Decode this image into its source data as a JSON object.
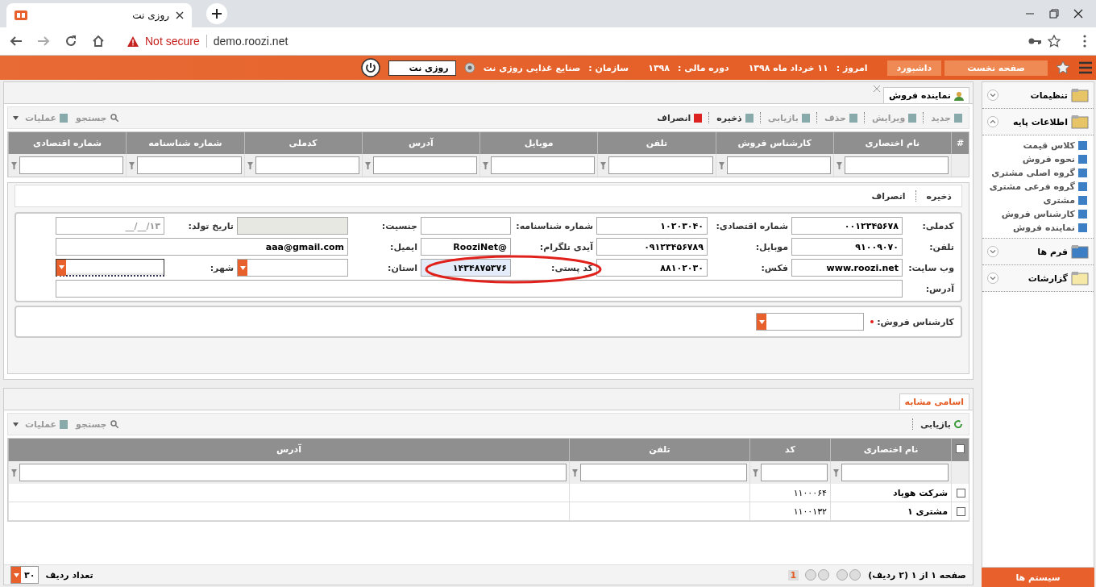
{
  "browser": {
    "tab_title": "روزی نت",
    "security": "Not secure",
    "url": "demo.roozi.net"
  },
  "header": {
    "buttons": [
      {
        "label": "صفحه نخست"
      },
      {
        "label": "داشبورد"
      }
    ],
    "info": [
      {
        "label": "امروز :",
        "value": "۱۱ خرداد ماه ۱۳۹۸"
      },
      {
        "label": "دوره مالی :",
        "value": "۱۳۹۸"
      },
      {
        "label": "سازمان :",
        "value": "صنایع غذایی روزی نت"
      }
    ],
    "company": "روزی نت"
  },
  "page_tab": {
    "label": "نماینده فروش"
  },
  "toolbar": {
    "actions": [
      {
        "label": "جدید",
        "disabled": true
      },
      {
        "label": "ویرایش",
        "disabled": true
      },
      {
        "label": "حذف",
        "disabled": true
      },
      {
        "label": "بازیابی",
        "disabled": true
      },
      {
        "label": "ذخیره",
        "disabled": false
      },
      {
        "label": "انصراف",
        "disabled": false
      }
    ],
    "search": "جستجو",
    "operations": "عملیات"
  },
  "grid": {
    "index_header": "#",
    "columns": [
      "نام اختصاری",
      "کارشناس فروش",
      "تلفن",
      "موبایل",
      "آدرس",
      "کدملی",
      "شماره شناسنامه",
      "شماره اقتصادی"
    ]
  },
  "form_toolbar": [
    "ذخیره",
    "انصراف"
  ],
  "form": {
    "rows": [
      [
        {
          "label": "کدملی:",
          "value": "۰۰۱۲۳۴۵۶۷۸",
          "kind": "text"
        },
        {
          "label": "شماره اقتصادی:",
          "value": "۱۰۲۰۳۰۴۰",
          "kind": "text"
        },
        {
          "label": "شماره شناسنامه:",
          "kind": "text"
        },
        {
          "label": "جنسیت:",
          "kind": "disabled"
        },
        {
          "label": "تاریخ تولد:",
          "placeholder": "__/__/۱۳",
          "kind": "date"
        }
      ],
      [
        {
          "label": "تلفن:",
          "value": "۹۱۰۰۹۰۷۰",
          "kind": "text"
        },
        {
          "label": "موبایل:",
          "value": "۰۹۱۲۳۴۵۶۷۸۹",
          "kind": "text"
        },
        {
          "label": "آیدی تلگرام:",
          "value": "RooziNet@",
          "kind": "text"
        },
        {
          "label": "ایمیل:",
          "value": "aaa@gmail.com",
          "kind": "text"
        }
      ],
      [
        {
          "label": "وب سایت:",
          "value": "www.roozi.net",
          "kind": "text"
        },
        {
          "label": "فکس:",
          "value": "۸۸۱۰۲۰۳۰",
          "kind": "text"
        },
        {
          "label": "کد پستی:",
          "value": "۱۴۳۴۸۷۵۳۷۶",
          "kind": "text",
          "highlighted": true
        },
        {
          "label": "استان:",
          "kind": "select"
        },
        {
          "label": "شهر:",
          "kind": "select",
          "focused": true
        }
      ],
      [
        {
          "label": "آدرس:",
          "kind": "text"
        }
      ]
    ],
    "sales_expert": {
      "label": "کارشناس فروش:",
      "required": true
    }
  },
  "similar": {
    "tab": {
      "label": "اسامی مشابه",
      "selected": true
    },
    "refresh": "بازیابی",
    "search": "جستجو",
    "operations": "عملیات",
    "columns": [
      "نام اختصاری",
      "کد",
      "تلفن",
      "آدرس"
    ],
    "all_checked": false,
    "rows": [
      {
        "checked": false,
        "cells": [
          "شرکت هویاد",
          "۱۱۰۰۰۶۴"
        ]
      },
      {
        "checked": false,
        "cells": [
          "مشتری ۱",
          "۱۱۰۰۱۳۲"
        ]
      }
    ]
  },
  "pager": {
    "summary": "صفحه ۱ از ۱ (۲ ردیف)",
    "page": "1",
    "size_label": "تعداد ردیف",
    "size": "۳۰"
  },
  "sidebar": {
    "groups": [
      {
        "label": "تنظیمات",
        "expanded": false
      },
      {
        "label": "اطلاعات پایه",
        "expanded": true,
        "items": [
          "کلاس قیمت",
          "نحوه فروش",
          "گروه اصلی مشتری",
          "گروه فرعی مشتری",
          "مشتری",
          "کارشناس فروش",
          "نماینده فروش"
        ]
      },
      {
        "label": "فرم ها",
        "expanded": false
      },
      {
        "label": "گزارشات",
        "expanded": false
      }
    ],
    "footer": "سیستم ها"
  }
}
